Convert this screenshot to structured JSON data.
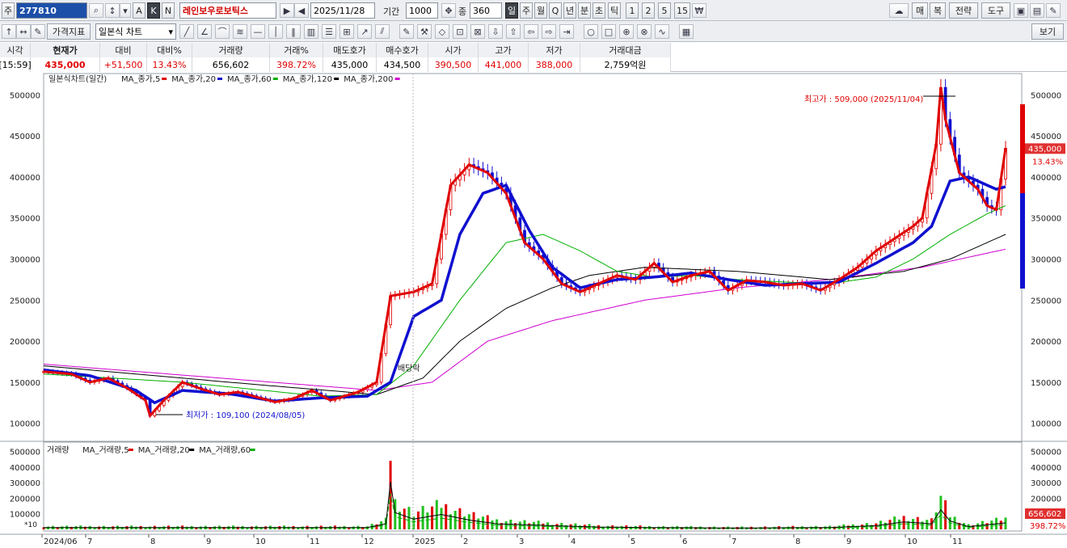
{
  "toolbar1": {
    "mode": "주",
    "code": "277810",
    "akn": [
      "A",
      "K",
      "N"
    ],
    "name": "레인보우로보틱스",
    "date": "2025/11/28",
    "period_label": "기간",
    "period_value": "1000",
    "count_label": "종",
    "count_value": "360",
    "intervals": [
      "일",
      "주",
      "월",
      "Q",
      "년",
      "분",
      "초",
      "틱",
      "1",
      "2",
      "5",
      "15"
    ],
    "right": [
      "매",
      "복",
      "전략",
      "도구"
    ]
  },
  "toolbar2": {
    "price_indicator": "가격지표",
    "chart_type": "일본식 차트",
    "view_button": "보기"
  },
  "quote": {
    "headers": [
      "시각",
      "현재가",
      "대비",
      "대비%",
      "거래량",
      "거래%",
      "매도호가",
      "매수호가",
      "시가",
      "고가",
      "저가",
      "거래대금"
    ],
    "values": [
      "[15:59]",
      "435,000",
      "+51,500",
      "13.43%",
      "656,602",
      "398.72%",
      "435,000",
      "434,500",
      "390,500",
      "441,000",
      "388,000",
      "2,759억원"
    ]
  },
  "chart_data": [
    {
      "type": "candlestick",
      "legend": "일본식차트(일간)",
      "series": [
        {
          "name": "MA_종가,5",
          "color": "#e00000"
        },
        {
          "name": "MA_종가,20",
          "color": "#1010d0"
        },
        {
          "name": "MA_종가,60",
          "color": "#00b000"
        },
        {
          "name": "MA_종가,120",
          "color": "#000000"
        },
        {
          "name": "MA_종가,200",
          "color": "#d000d0"
        }
      ],
      "y_ticks": [
        "500000",
        "450000",
        "400000",
        "350000",
        "300000",
        "250000",
        "200000",
        "150000",
        "100000"
      ],
      "ylim": [
        80000,
        520000
      ],
      "x_ticks": [
        "2024/06",
        "7",
        "8",
        "9",
        "10",
        "11",
        "12",
        "2025",
        "2",
        "3",
        "4",
        "5",
        "6",
        "7",
        "8",
        "9",
        "10",
        "11"
      ],
      "price_path": [
        [
          0,
          163000
        ],
        [
          6,
          160000
        ],
        [
          10,
          150000
        ],
        [
          14,
          155000
        ],
        [
          18,
          143000
        ],
        [
          22,
          128000
        ],
        [
          23,
          109100
        ],
        [
          26,
          128000
        ],
        [
          30,
          150000
        ],
        [
          34,
          142000
        ],
        [
          38,
          135000
        ],
        [
          42,
          138000
        ],
        [
          46,
          132000
        ],
        [
          50,
          126000
        ],
        [
          54,
          130000
        ],
        [
          58,
          140000
        ],
        [
          62,
          128000
        ],
        [
          68,
          138000
        ],
        [
          72,
          150000
        ],
        [
          75,
          255000
        ],
        [
          80,
          260000
        ],
        [
          84,
          270000
        ],
        [
          88,
          390000
        ],
        [
          92,
          415000
        ],
        [
          96,
          405000
        ],
        [
          100,
          380000
        ],
        [
          104,
          320000
        ],
        [
          108,
          300000
        ],
        [
          112,
          270000
        ],
        [
          116,
          260000
        ],
        [
          120,
          270000
        ],
        [
          124,
          280000
        ],
        [
          128,
          275000
        ],
        [
          132,
          295000
        ],
        [
          136,
          272000
        ],
        [
          140,
          280000
        ],
        [
          144,
          285000
        ],
        [
          148,
          262000
        ],
        [
          152,
          274000
        ],
        [
          156,
          272000
        ],
        [
          160,
          268000
        ],
        [
          164,
          270000
        ],
        [
          168,
          262000
        ],
        [
          172,
          275000
        ],
        [
          176,
          290000
        ],
        [
          180,
          310000
        ],
        [
          184,
          325000
        ],
        [
          188,
          340000
        ],
        [
          190,
          350000
        ],
        [
          193,
          440000
        ],
        [
          194,
          509000
        ],
        [
          195,
          470000
        ],
        [
          198,
          405000
        ],
        [
          202,
          385000
        ],
        [
          204,
          365000
        ],
        [
          206,
          360000
        ],
        [
          208,
          435000
        ]
      ],
      "ma20_path": [
        [
          0,
          165000
        ],
        [
          10,
          158000
        ],
        [
          20,
          140000
        ],
        [
          24,
          125000
        ],
        [
          30,
          140000
        ],
        [
          40,
          136000
        ],
        [
          50,
          127000
        ],
        [
          60,
          131000
        ],
        [
          70,
          133000
        ],
        [
          75,
          150000
        ],
        [
          80,
          230000
        ],
        [
          86,
          250000
        ],
        [
          90,
          330000
        ],
        [
          95,
          380000
        ],
        [
          100,
          390000
        ],
        [
          105,
          335000
        ],
        [
          110,
          290000
        ],
        [
          116,
          265000
        ],
        [
          124,
          275000
        ],
        [
          132,
          278000
        ],
        [
          140,
          283000
        ],
        [
          148,
          275000
        ],
        [
          156,
          268000
        ],
        [
          164,
          270000
        ],
        [
          172,
          272000
        ],
        [
          180,
          295000
        ],
        [
          188,
          320000
        ],
        [
          192,
          340000
        ],
        [
          196,
          395000
        ],
        [
          200,
          400000
        ],
        [
          206,
          385000
        ],
        [
          208,
          388000
        ]
      ],
      "ma60_path": [
        [
          0,
          160000
        ],
        [
          30,
          150000
        ],
        [
          60,
          133000
        ],
        [
          72,
          135000
        ],
        [
          80,
          170000
        ],
        [
          90,
          250000
        ],
        [
          100,
          320000
        ],
        [
          108,
          330000
        ],
        [
          116,
          310000
        ],
        [
          124,
          285000
        ],
        [
          132,
          278000
        ],
        [
          140,
          280000
        ],
        [
          150,
          275000
        ],
        [
          160,
          272000
        ],
        [
          170,
          270000
        ],
        [
          180,
          278000
        ],
        [
          188,
          300000
        ],
        [
          196,
          330000
        ],
        [
          204,
          355000
        ],
        [
          208,
          365000
        ]
      ],
      "ma120_path": [
        [
          0,
          170000
        ],
        [
          40,
          150000
        ],
        [
          72,
          135000
        ],
        [
          82,
          155000
        ],
        [
          90,
          200000
        ],
        [
          100,
          240000
        ],
        [
          110,
          265000
        ],
        [
          118,
          280000
        ],
        [
          130,
          290000
        ],
        [
          150,
          285000
        ],
        [
          170,
          275000
        ],
        [
          186,
          285000
        ],
        [
          196,
          300000
        ],
        [
          208,
          330000
        ]
      ],
      "ma200_path": [
        [
          0,
          172000
        ],
        [
          72,
          140000
        ],
        [
          84,
          150000
        ],
        [
          96,
          200000
        ],
        [
          110,
          225000
        ],
        [
          130,
          250000
        ],
        [
          150,
          265000
        ],
        [
          170,
          275000
        ],
        [
          190,
          290000
        ],
        [
          208,
          312000
        ]
      ],
      "annotations": [
        "최고가 : 509,000 (2025/11/04)",
        "최저가 : 109,100 (2024/08/05)",
        "배당락"
      ],
      "last_price": "435,000",
      "last_change": "13.43%"
    },
    {
      "type": "bar",
      "legend": "거래량",
      "series": [
        {
          "name": "MA_거래량,5",
          "color": "#e00000"
        },
        {
          "name": "MA_거래량,20",
          "color": "#000000"
        },
        {
          "name": "MA_거래량,60",
          "color": "#00b000"
        }
      ],
      "y_ticks": [
        "500000",
        "400000",
        "300000",
        "200000",
        "100000"
      ],
      "ylim": [
        0,
        540000
      ],
      "volume_path": [
        [
          0,
          20000
        ],
        [
          70,
          20000
        ],
        [
          74,
          60000
        ],
        [
          75,
          510000
        ],
        [
          76,
          180000
        ],
        [
          80,
          110000
        ],
        [
          86,
          160000
        ],
        [
          92,
          100000
        ],
        [
          98,
          60000
        ],
        [
          104,
          50000
        ],
        [
          110,
          40000
        ],
        [
          120,
          25000
        ],
        [
          130,
          20000
        ],
        [
          150,
          15000
        ],
        [
          170,
          20000
        ],
        [
          180,
          40000
        ],
        [
          186,
          80000
        ],
        [
          192,
          60000
        ],
        [
          194,
          210000
        ],
        [
          196,
          90000
        ],
        [
          200,
          30000
        ],
        [
          208,
          70000
        ]
      ],
      "last_volume": "656,602",
      "last_ratio": "398.72%"
    }
  ],
  "bottom_scale_label": "*10"
}
